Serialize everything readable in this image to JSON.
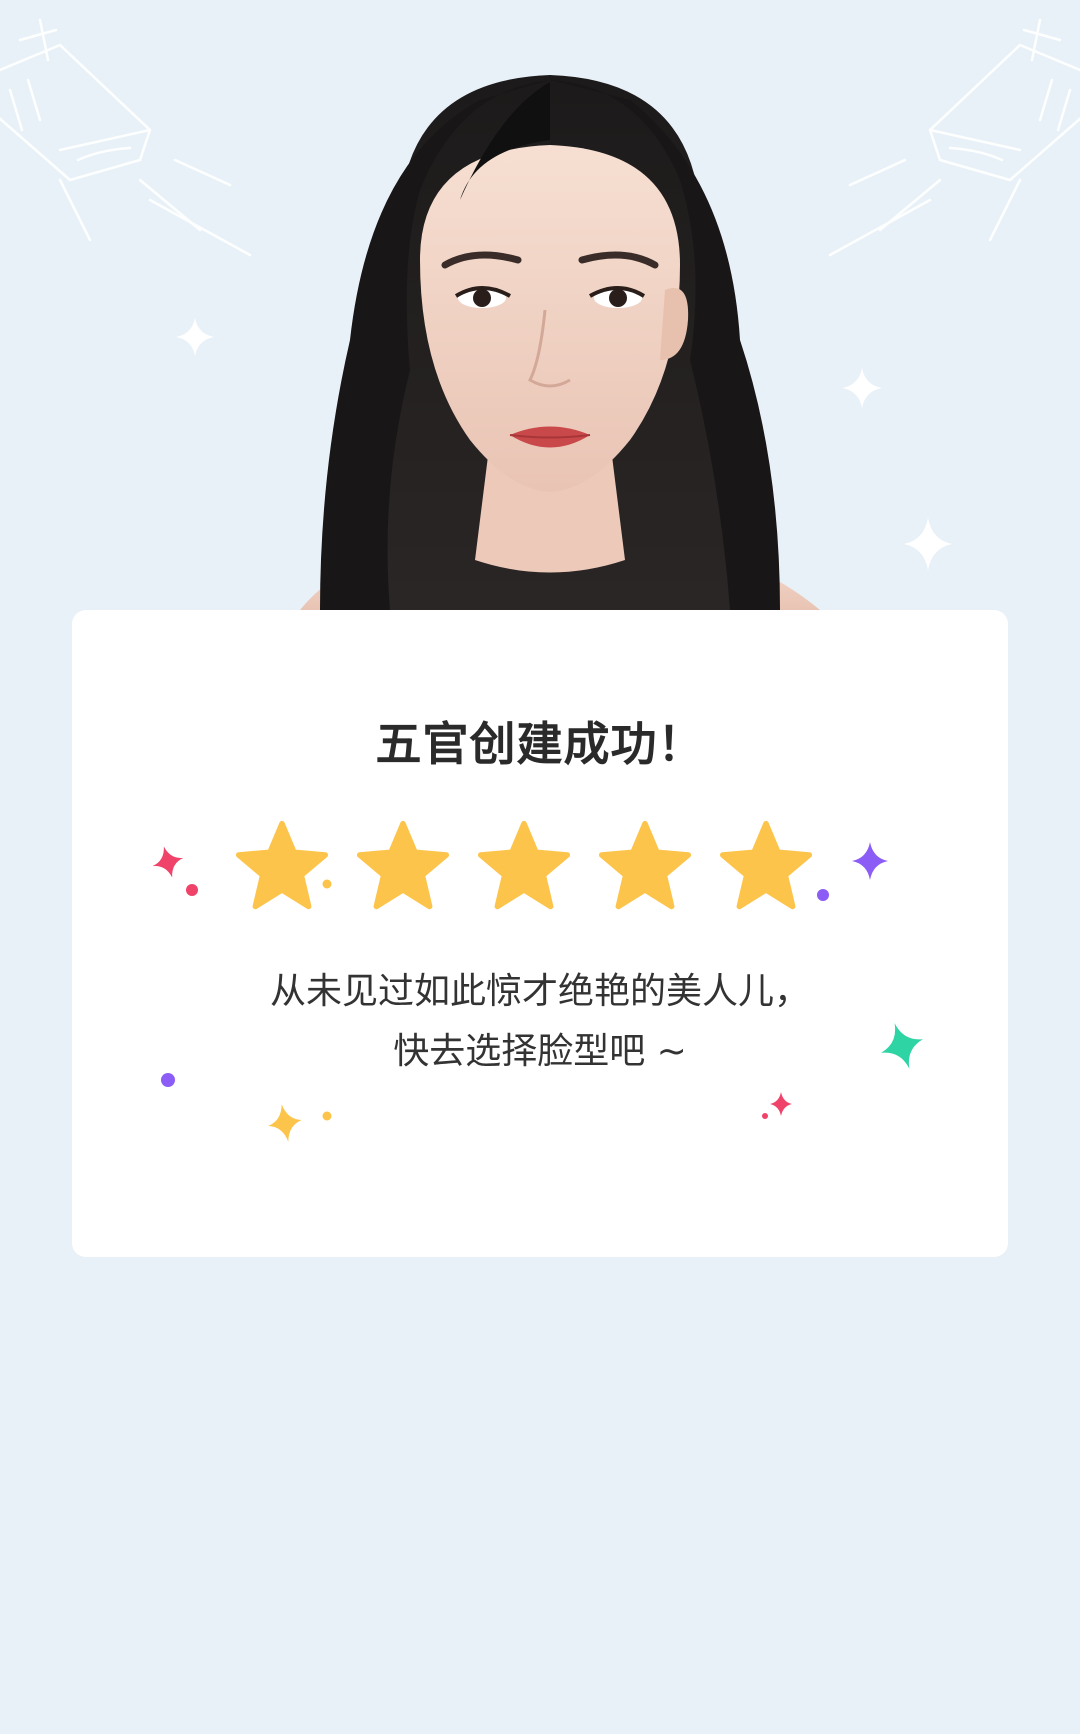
{
  "colors": {
    "background": "#e9f1f8",
    "card": "#ffffff",
    "star": "#fcc44a",
    "title": "#2a2a2a",
    "message": "#333333"
  },
  "rating": {
    "value": 5,
    "max": 5,
    "icon": "star-icon"
  },
  "card": {
    "title": "五官创建成功！",
    "message_line1": "从未见过如此惊才绝艳的美人儿，",
    "message_line2": "快去选择脸型吧 ~"
  }
}
